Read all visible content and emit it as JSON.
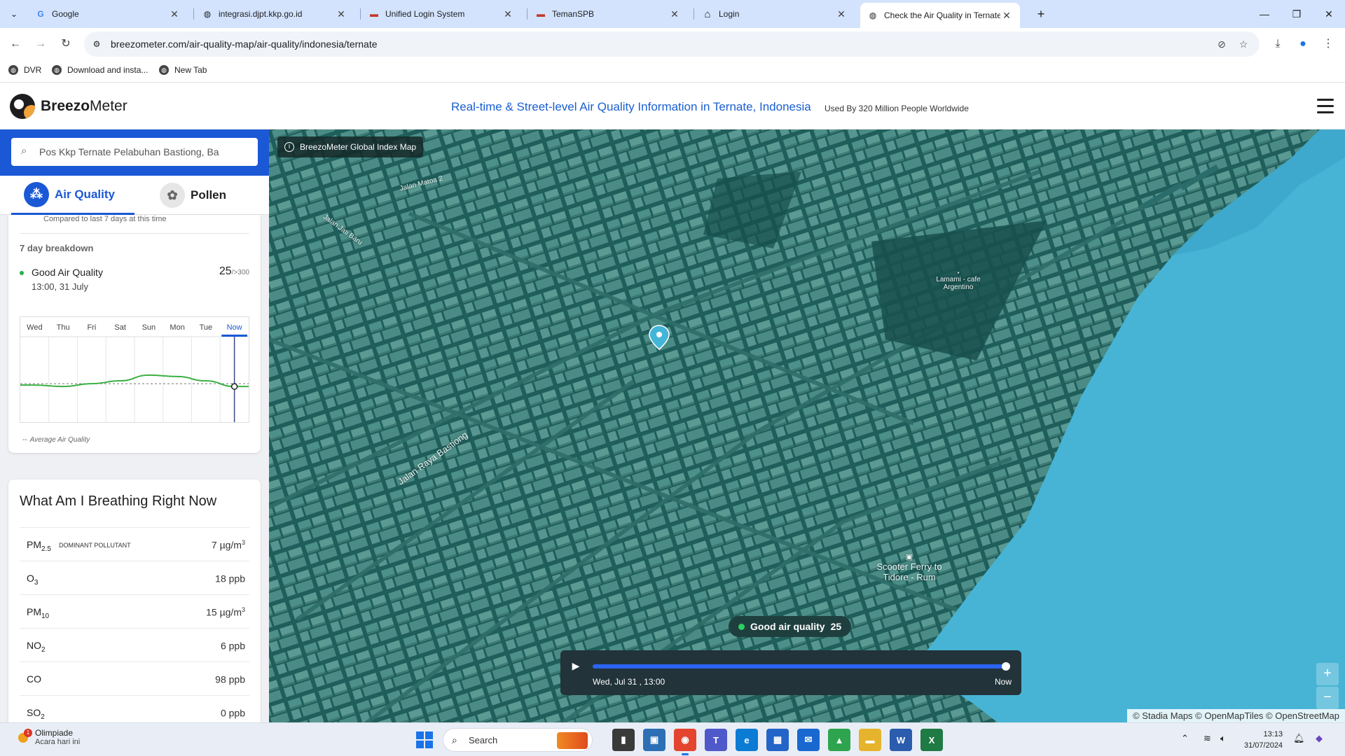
{
  "browser": {
    "tabs": [
      {
        "title": "Google",
        "icon": "google-icon",
        "glyph": "G"
      },
      {
        "title": "integrasi.djpt.kkp.go.id",
        "icon": "globe-icon",
        "glyph": "◍"
      },
      {
        "title": "Unified Login System",
        "icon": "site-icon",
        "glyph": "▬"
      },
      {
        "title": "TemanSPB",
        "icon": "site-icon",
        "glyph": "▬"
      },
      {
        "title": "Login",
        "icon": "home-icon",
        "glyph": "⌂"
      },
      {
        "title": "Check the Air Quality in Ternate",
        "icon": "globe-icon",
        "glyph": "◍"
      }
    ],
    "url": "breezometer.com/air-quality-map/air-quality/indonesia/ternate",
    "bookmarks": [
      {
        "label": "DVR"
      },
      {
        "label": "Download and insta..."
      },
      {
        "label": "New Tab"
      }
    ]
  },
  "header": {
    "logo_bold": "Breezo",
    "logo_rest": "Meter",
    "headline": "Real-time & Street-level Air Quality Information in Ternate, Indonesia",
    "subline": "Used By 320 Million People Worldwide"
  },
  "sidebar": {
    "search_value": "Pos Kkp Ternate Pelabuhan Bastiong, Ba",
    "tabs": [
      {
        "label": "Air Quality",
        "active": true
      },
      {
        "label": "Pollen",
        "active": false
      }
    ],
    "compare_note": "Compared to last 7 days at this time",
    "breakdown_title": "7 day breakdown",
    "quality_label": "Good Air Quality",
    "quality_time": "13:00, 31 July",
    "quality_value": "25",
    "quality_max": "/>300",
    "avg_legend": "Average Air Quality",
    "breathing_title": "What Am I Breathing Right Now",
    "dominant_label": "DOMINANT POLLUTANT",
    "pollutants": [
      {
        "base": "PM",
        "sub": "2.5",
        "value": "7 µg/m",
        "sup": "3",
        "dominant": true
      },
      {
        "base": "O",
        "sub": "3",
        "value": "18 ppb",
        "sup": "",
        "dominant": false
      },
      {
        "base": "PM",
        "sub": "10",
        "value": "15 µg/m",
        "sup": "3",
        "dominant": false
      },
      {
        "base": "NO",
        "sub": "2",
        "value": "6 ppb",
        "sup": "",
        "dominant": false
      },
      {
        "base": "CO",
        "sub": "",
        "value": "98 ppb",
        "sup": "",
        "dominant": false
      },
      {
        "base": "SO",
        "sub": "2",
        "value": "0 ppb",
        "sup": "",
        "dominant": false
      }
    ]
  },
  "chart_data": {
    "type": "line",
    "categories": [
      "Wed",
      "Thu",
      "Fri",
      "Sat",
      "Sun",
      "Mon",
      "Tue",
      "Now"
    ],
    "selected": "Now",
    "series": [
      {
        "values": [
          26,
          25,
          27,
          29,
          33,
          32,
          29,
          25
        ],
        "color": "#3cb043"
      }
    ],
    "average": 27,
    "ylim": [
      0,
      60
    ],
    "title": "",
    "xlabel": "",
    "ylabel": ""
  },
  "map": {
    "badge": "BreezoMeter Global Index Map",
    "labels": {
      "jalan_matoa": "Jalan Matoa 2",
      "jalan_jati": "Jalan Jati Baru",
      "jalan_raya": "Jalan Raya Bastiong",
      "lamami": "Lamami - cafe Argentino",
      "scooter": "Scooter Ferry to Tidore - Rum"
    },
    "pill_label": "Good air quality",
    "pill_value": "25",
    "timeline_time": "Wed, Jul 31 , 13:00",
    "timeline_now": "Now",
    "timeline_progress": 1.0,
    "attribution": "© Stadia Maps © OpenMapTiles © OpenStreetMap",
    "zoom_in": "+",
    "zoom_out": "−"
  },
  "taskbar": {
    "weather_title": "Olimpiade",
    "weather_sub": "Acara hari ini",
    "weather_badge": "1",
    "search_label": "Search",
    "time": "13:13",
    "date": "31/07/2024",
    "apps": [
      {
        "name": "file-explorer-dark-icon",
        "glyph": "▮",
        "color": "#3a3a3a"
      },
      {
        "name": "image-viewer-icon",
        "glyph": "▣",
        "color": "#2d6fb5"
      },
      {
        "name": "chrome-icon",
        "glyph": "◉",
        "color": "#e3452f"
      },
      {
        "name": "teams-icon",
        "glyph": "T",
        "color": "#5059c9"
      },
      {
        "name": "edge-icon",
        "glyph": "e",
        "color": "#0c7bd3"
      },
      {
        "name": "store-icon",
        "glyph": "▦",
        "color": "#2364c8"
      },
      {
        "name": "mail-icon",
        "glyph": "✉",
        "color": "#1868d0"
      },
      {
        "name": "drive-icon",
        "glyph": "▲",
        "color": "#2ea44f"
      },
      {
        "name": "folder-icon",
        "glyph": "▬",
        "color": "#e6b32c"
      },
      {
        "name": "word-icon",
        "glyph": "W",
        "color": "#2b5cad"
      },
      {
        "name": "excel-icon",
        "glyph": "X",
        "color": "#1f7a43"
      }
    ]
  }
}
